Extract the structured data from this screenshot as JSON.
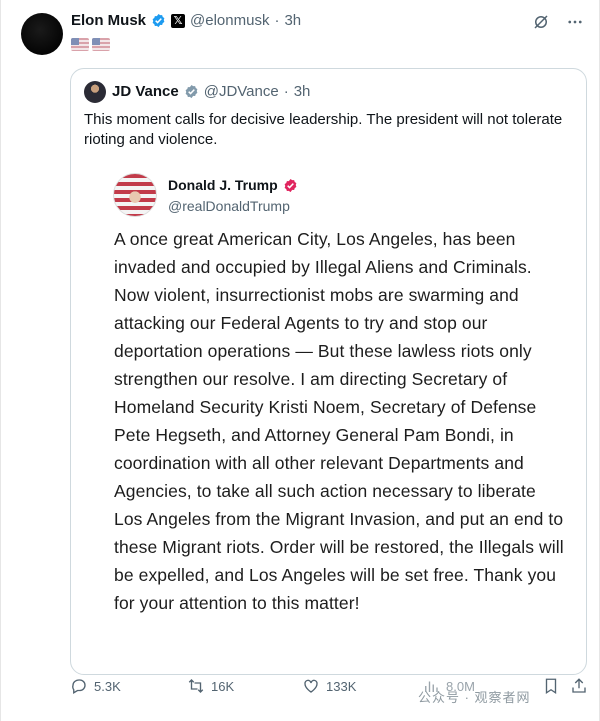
{
  "author": {
    "name": "Elon Musk",
    "handle": "@elonmusk",
    "time": "3h"
  },
  "quoted": {
    "name": "JD Vance",
    "handle": "@JDVance",
    "time": "3h",
    "text": "This moment calls for decisive leadership. The president will not tolerate rioting and violence."
  },
  "embedded": {
    "name": "Donald J. Trump",
    "handle": "@realDonaldTrump",
    "text": "A once great American City, Los Angeles, has been invaded and occupied by Illegal Aliens and Criminals.  Now violent, insurrectionist mobs are swarming and attacking our Federal Agents to try and stop our deportation operations — But these lawless riots only strengthen our resolve. I am directing Secretary of Homeland Security Kristi Noem, Secretary of Defense Pete Hegseth, and Attorney General Pam Bondi, in coordination with all other relevant Departments and Agencies, to take all such action necessary to liberate Los Angeles from the Migrant Invasion, and put an end to these Migrant riots. Order will be restored, the Illegals will be expelled, and Los Angeles will be set free. Thank you for your attention to this matter!"
  },
  "metrics": {
    "replies": "5.3K",
    "reposts": "16K",
    "likes": "133K",
    "views": "8.0M"
  },
  "watermark": "公众号 · 观察者网",
  "colors": {
    "verified_blue": "#1d9bf0",
    "verified_gray": "#829aab",
    "verified_pink": "#e0245e",
    "muted": "#536471",
    "border": "#cfd9de"
  },
  "icons": {
    "grok": "grok-icon",
    "more": "more-icon",
    "reply": "reply-icon",
    "repost": "repost-icon",
    "like": "like-icon",
    "views": "views-icon",
    "bookmark": "bookmark-icon",
    "share": "share-icon"
  }
}
